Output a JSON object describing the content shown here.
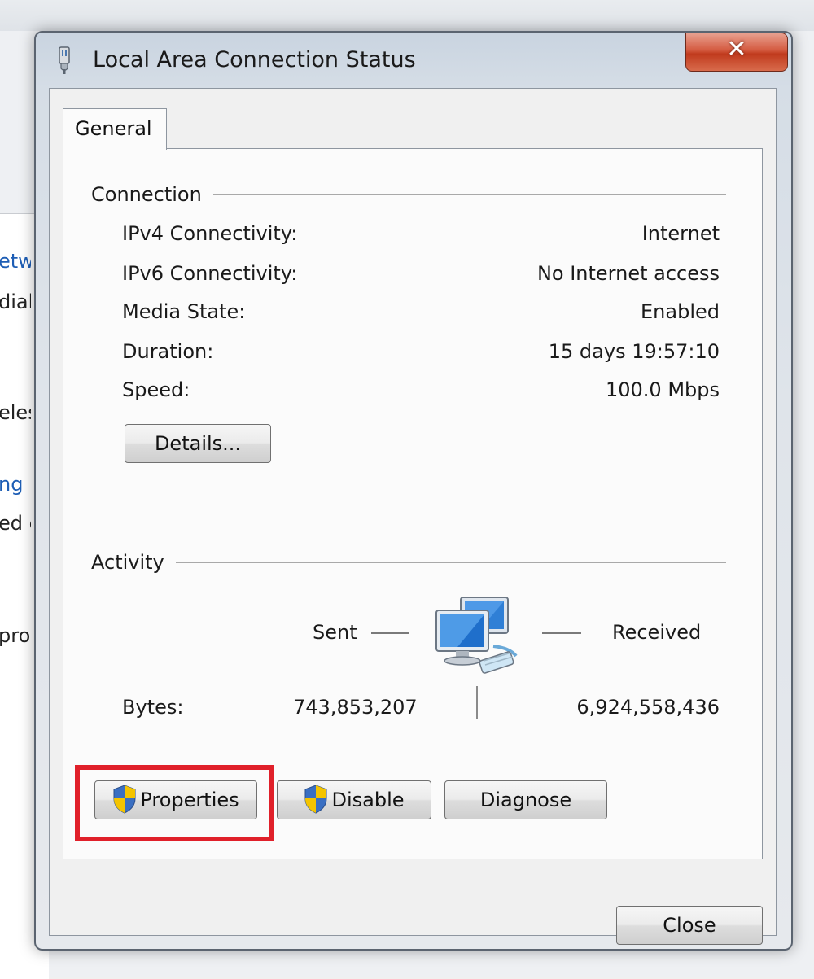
{
  "window": {
    "title": "Local Area Connection Status",
    "close_glyph": "✕"
  },
  "tabs": [
    {
      "label": "General"
    }
  ],
  "connection": {
    "group_label": "Connection",
    "rows": [
      {
        "label": "IPv4 Connectivity:",
        "value": "Internet"
      },
      {
        "label": "IPv6 Connectivity:",
        "value": "No Internet access"
      },
      {
        "label": "Media State:",
        "value": "Enabled"
      },
      {
        "label": "Duration:",
        "value": "15 days 19:57:10"
      },
      {
        "label": "Speed:",
        "value": "100.0 Mbps"
      }
    ],
    "details_button": "Details..."
  },
  "activity": {
    "group_label": "Activity",
    "sent_label": "Sent",
    "received_label": "Received",
    "bytes_label": "Bytes:",
    "bytes_sent": "743,853,207",
    "bytes_received": "6,924,558,436",
    "icon": "network-computers-icon"
  },
  "actions": {
    "properties": "Properties",
    "disable": "Disable",
    "diagnose": "Diagnose",
    "close": "Close"
  },
  "background_window": {
    "fragments": [
      "etw",
      "dial",
      "eles",
      "ng",
      "ed c",
      "prob"
    ]
  },
  "colors": {
    "highlight": "#e0202a",
    "close_button": "#c03a1d",
    "link": "#1e5eb5"
  }
}
